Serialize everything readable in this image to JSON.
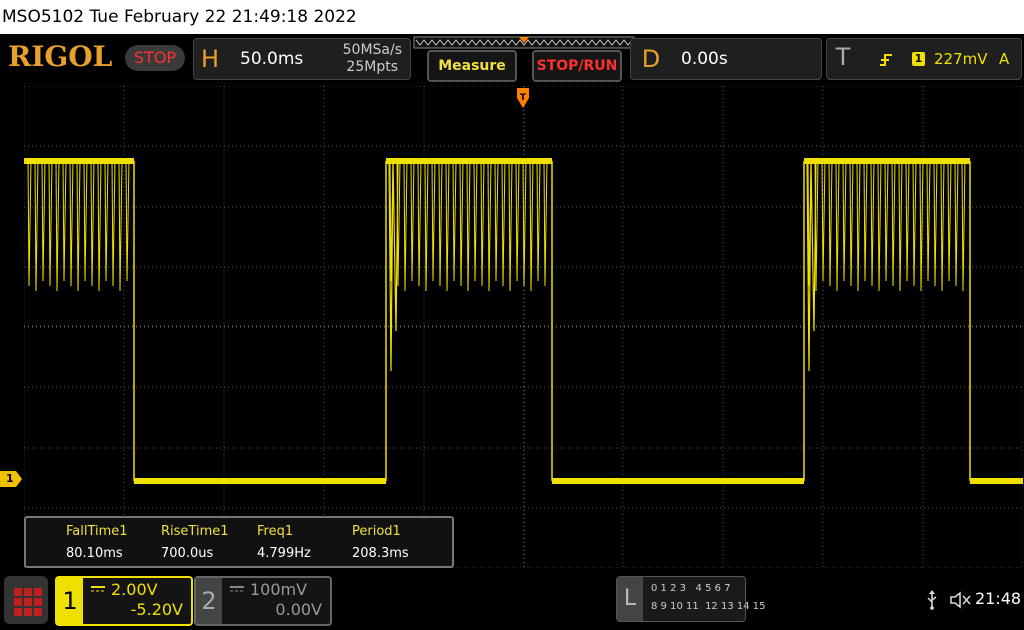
{
  "title_bar": {
    "text": "MSO5102  Tue February 22 21:49:18 2022"
  },
  "brand": {
    "logo": "RIGOL",
    "run_state": "STOP"
  },
  "horizontal": {
    "letter": "H",
    "timebase": "50.0ms",
    "sample_rate": "50MSa/s",
    "memory_depth": "25Mpts"
  },
  "buttons": {
    "measure": "Measure",
    "stop_run": "STOP/RUN"
  },
  "delay": {
    "letter": "D",
    "value": "0.00s"
  },
  "trigger": {
    "letter": "T",
    "source": "1",
    "level": "227mV",
    "mode": "A"
  },
  "channel1": {
    "number": "1",
    "scale": "2.00V",
    "offset": "-5.20V",
    "color": "#f0e000",
    "marker": "1"
  },
  "channel2": {
    "number": "2",
    "scale": "100mV",
    "offset": "0.00V"
  },
  "measurements": {
    "headers": [
      "FallTime1",
      "RiseTime1",
      "Freq1",
      "Period1"
    ],
    "values": [
      "80.10ms",
      "700.0us",
      "4.799Hz",
      "208.3ms"
    ]
  },
  "logic": {
    "letter": "L",
    "row1": "0 1 2 3   4 5 6 7",
    "row2": "8 9 10 11  12 13 14 15"
  },
  "status": {
    "usb_icon": "usb-icon",
    "sound_icon": "speaker-muted-icon",
    "clock": "21:48"
  },
  "waveform": {
    "color": "#f0e000",
    "high_level_pct": 0.85,
    "low_level_pct": 0.0
  }
}
